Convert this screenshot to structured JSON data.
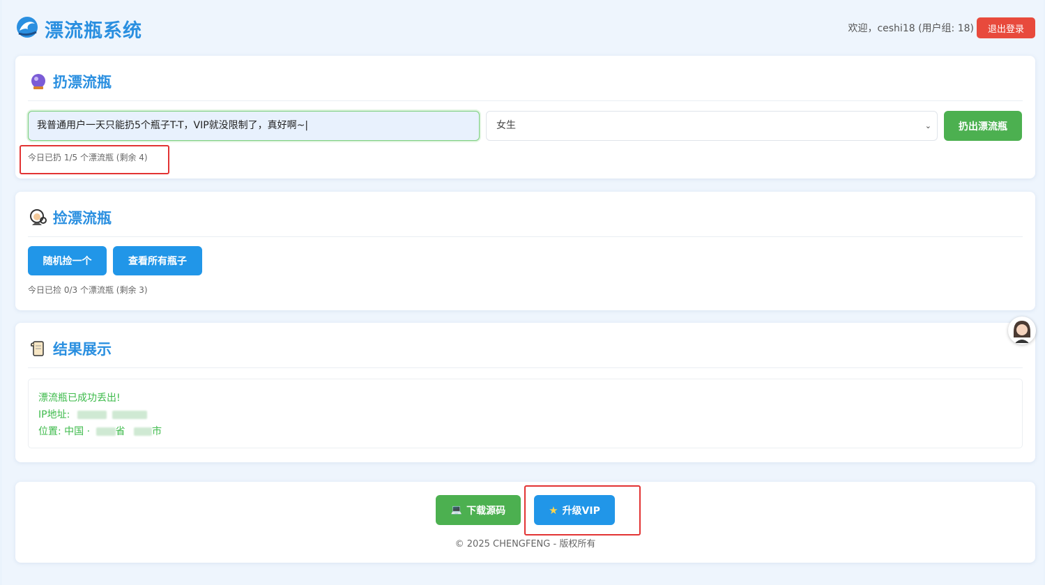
{
  "header": {
    "app_title": "漂流瓶系统",
    "welcome_text": "欢迎，ceshi18 (用户组: 18)",
    "logout_label": "退出登录",
    "logo_icon": "wave-icon"
  },
  "throw_section": {
    "title": "扔漂流瓶",
    "title_icon": "crystal-ball-icon",
    "message_value": "我普通用户一天只能扔5个瓶子T-T，VIP就没限制了，真好啊~|",
    "gender_selected": "女生",
    "submit_label": "扔出漂流瓶",
    "quota_text": "今日已扔 1/5 个漂流瓶 (剩余 4)"
  },
  "pick_section": {
    "title": "捡漂流瓶",
    "title_icon": "detective-icon",
    "random_label": "随机捡一个",
    "view_all_label": "查看所有瓶子",
    "quota_text": "今日已捡 0/3 个漂流瓶 (剩余 3)"
  },
  "result_section": {
    "title": "结果展示",
    "title_icon": "scroll-icon",
    "success_text": "漂流瓶已成功丢出!",
    "ip_label": "IP地址:",
    "location_prefix": "位置: 中国 ·",
    "province_suffix": "省",
    "city_suffix": "市"
  },
  "footer": {
    "download_label": "下载源码",
    "download_icon": "laptop-icon",
    "vip_label": "升级VIP",
    "vip_icon": "star-icon",
    "copyright": "© 2025 CHENGFENG - 版权所有"
  },
  "colors": {
    "accent": "#2a8fe0",
    "success": "#4cb050",
    "danger": "#e84a3c",
    "primary_button": "#2196e8",
    "highlight_box": "#e23333"
  }
}
